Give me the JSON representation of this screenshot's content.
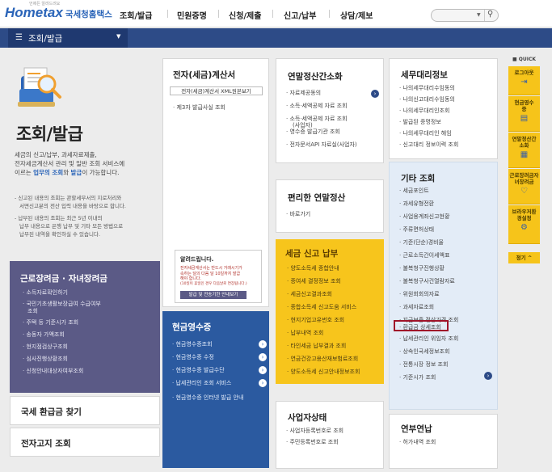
{
  "header": {
    "logo_en": "Hometax",
    "logo_ko": "국세청홈택스",
    "logo_tiny": "언제든 알려드려요",
    "nav": [
      "조회/발급",
      "민원증명",
      "신청/제출",
      "신고/납부",
      "상담/제보"
    ]
  },
  "subnav": {
    "current": "조회/발급"
  },
  "hero": {
    "title": "조회/발급",
    "desc1": "세금의 신고/납부, 과세자료제출,",
    "desc2": "전자세금계산서 관리 및 일반 조회 서비스에",
    "desc3_pre": "이르는 ",
    "desc3_hl1": "업무의 조회",
    "desc3_mid": "와 ",
    "desc3_hl2": "발급",
    "desc3_post": "이 가능합니다.",
    "note1a": "- 신고된 내용의 조회는 관할세무서의 지로처리와",
    "note1b": "서면신고분의 전산 입력 내용을 바탕으로 합니다.",
    "note2a": "- 납부된 내용의 조회는 최근 5년 이내의",
    "note2b": "납부 내용으로 은행 납부 및 기타 모든 방법으로",
    "note2c": "납부된 내역을 확인하실 수 있습니다."
  },
  "labor": {
    "title": "근로장려금 · 자녀장려금",
    "items": [
      "소득자료확인하기",
      "국민기초생활보장급여 수급여부",
      "조회",
      "주택 등 기준시가 조회",
      "송동자 가액조회",
      "현지점검상구조회",
      "심사진행상황조회",
      "신청안내대상자여부조회"
    ]
  },
  "refund": {
    "title": "국세 환급금 찾기"
  },
  "enotice": {
    "title": "전자고지 조회"
  },
  "einvoice": {
    "title": "전자(세금)계산서",
    "btn": "전자(세금)계산서 XML원본보기",
    "items": [
      "제3자 발급사실 조회"
    ]
  },
  "yearend": {
    "title": "연말정산간소화",
    "items": [
      "자료제공동의",
      "소득·세액공제 자료 조회",
      "소득·세액공제 자료 조회",
      "(사업자)",
      "영수증 발급기관 조회",
      "전자문서API 자료실(사업자)"
    ]
  },
  "convenient": {
    "title": "편리한 연말정산",
    "items": [
      "바로가기"
    ]
  },
  "notice": {
    "title": "알려드립니다.",
    "line1": "전자세금계산서는 반드시 거래시기가",
    "line2": "속하는 달의 다음 달 10일까지 발급",
    "line3": "해야 합니다.",
    "line4": "(10일이 휴일인 경우 다음날로 연장됩니다.)",
    "btn": "발급 및 전송기한 안내보기"
  },
  "receipts": {
    "title": "현금영수증",
    "items": [
      "현금영수증조회",
      "현금영수증 수정",
      "현금영수증 발급수단",
      "납세관리인 조회 서비스",
      "현금영수증 인터넷 발급 안내"
    ]
  },
  "taxreport": {
    "title": "세금 신고 납부",
    "items": [
      "양도소득세 종합안내",
      "증여세 결정정보 조회",
      "세금신고결과조회",
      "종합소득세 신고도움 서비스",
      "현지기업고유번호 조회",
      "납부내역 조회",
      "타인세금 납부결과 조회",
      "연금건강고용산재보험료조회",
      "양도소득세 신고안내정보조회"
    ]
  },
  "business": {
    "title": "사업자상태",
    "items": [
      "사업자등록번호로 조회",
      "주민등록번호로 조회"
    ]
  },
  "agent": {
    "title": "세무대리정보",
    "items": [
      "나의세무대리수임동의",
      "나의신고대리수임동의",
      "나의세무대리인조회",
      "발급된 증명정보",
      "나의세무대리인 해임",
      "신고대리 정보이력 조회"
    ]
  },
  "etc": {
    "title": "기타 조회",
    "items": [
      "세금포인트",
      "과세유형전환",
      "사업용계좌신고현황",
      "주류면허상태",
      "기준(단순)경비율",
      "근로소득간이세액표",
      "불복청구진행상황",
      "불복청구사건열람자료",
      "위원회회의자료",
      "과세자료조회",
      "지급보증 정상가격 조회",
      "환급금 상세조회",
      "납세관리인 위임자 조회",
      "상속인국세정보조회",
      "전통시장 정보 조회",
      "기준시가 조회"
    ]
  },
  "yearpension": {
    "title": "연부연납",
    "items": [
      "허가내역 조회"
    ]
  },
  "quick": {
    "title": "QUICK",
    "items": [
      "로그아웃",
      "현금영수증",
      "연말정산간소화",
      "근로장려금자녀장려금",
      "브라우저환경설정"
    ],
    "top": "정기 ^"
  },
  "search": {
    "label": ""
  }
}
